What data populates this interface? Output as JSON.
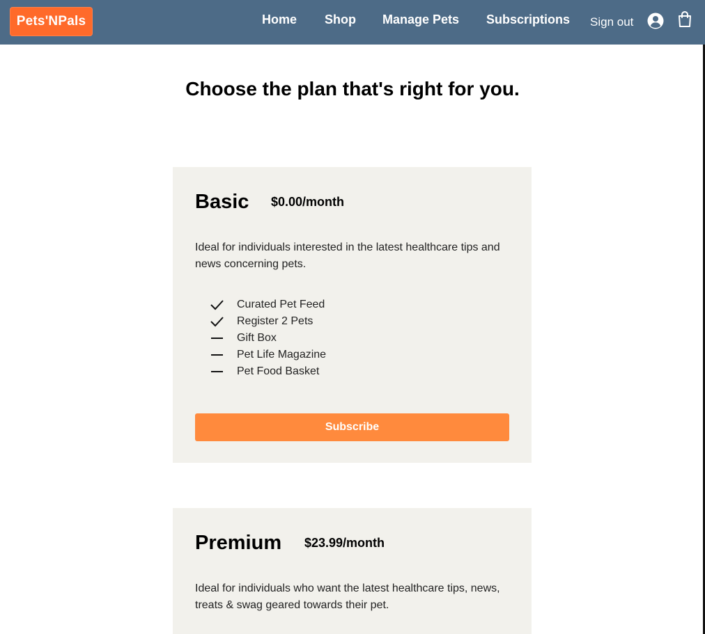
{
  "nav": {
    "logo": "Pets'NPals",
    "links": [
      "Home",
      "Shop",
      "Manage Pets",
      "Subscriptions"
    ],
    "sign_out": "Sign out",
    "account_icon": "user-circle-icon",
    "cart_icon": "shopping-bag-icon"
  },
  "page": {
    "heading": "Choose the plan that's right for you."
  },
  "plans": [
    {
      "name": "Basic",
      "price": "$0.00/month",
      "description": "Ideal for individuals interested in the latest healthcare tips and news concerning pets.",
      "features": [
        {
          "label": "Curated Pet Feed",
          "included": true
        },
        {
          "label": "Register 2 Pets",
          "included": true
        },
        {
          "label": "Gift Box",
          "included": false
        },
        {
          "label": "Pet Life Magazine",
          "included": false
        },
        {
          "label": "Pet Food Basket",
          "included": false
        }
      ],
      "button": "Subscribe"
    },
    {
      "name": "Premium",
      "price": "$23.99/month",
      "description": "Ideal for individuals who want the latest healthcare tips, news, treats & swag geared towards their pet."
    }
  ],
  "colors": {
    "navbar": "#4d6b87",
    "logo_bg": "#ff6a2a",
    "card_bg": "#f2f1ec",
    "button_bg": "#ff8a3d"
  }
}
